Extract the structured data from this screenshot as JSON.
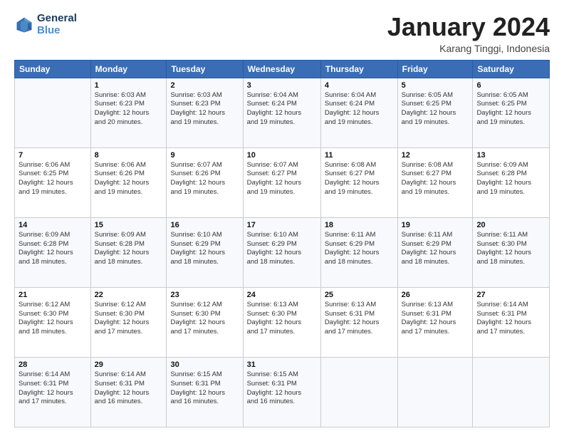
{
  "logo": {
    "line1": "General",
    "line2": "Blue"
  },
  "title": "January 2024",
  "location": "Karang Tinggi, Indonesia",
  "days_of_week": [
    "Sunday",
    "Monday",
    "Tuesday",
    "Wednesday",
    "Thursday",
    "Friday",
    "Saturday"
  ],
  "weeks": [
    [
      {
        "day": "",
        "info": ""
      },
      {
        "day": "1",
        "info": "Sunrise: 6:03 AM\nSunset: 6:23 PM\nDaylight: 12 hours\nand 20 minutes."
      },
      {
        "day": "2",
        "info": "Sunrise: 6:03 AM\nSunset: 6:23 PM\nDaylight: 12 hours\nand 19 minutes."
      },
      {
        "day": "3",
        "info": "Sunrise: 6:04 AM\nSunset: 6:24 PM\nDaylight: 12 hours\nand 19 minutes."
      },
      {
        "day": "4",
        "info": "Sunrise: 6:04 AM\nSunset: 6:24 PM\nDaylight: 12 hours\nand 19 minutes."
      },
      {
        "day": "5",
        "info": "Sunrise: 6:05 AM\nSunset: 6:25 PM\nDaylight: 12 hours\nand 19 minutes."
      },
      {
        "day": "6",
        "info": "Sunrise: 6:05 AM\nSunset: 6:25 PM\nDaylight: 12 hours\nand 19 minutes."
      }
    ],
    [
      {
        "day": "7",
        "info": "Sunrise: 6:06 AM\nSunset: 6:25 PM\nDaylight: 12 hours\nand 19 minutes."
      },
      {
        "day": "8",
        "info": "Sunrise: 6:06 AM\nSunset: 6:26 PM\nDaylight: 12 hours\nand 19 minutes."
      },
      {
        "day": "9",
        "info": "Sunrise: 6:07 AM\nSunset: 6:26 PM\nDaylight: 12 hours\nand 19 minutes."
      },
      {
        "day": "10",
        "info": "Sunrise: 6:07 AM\nSunset: 6:27 PM\nDaylight: 12 hours\nand 19 minutes."
      },
      {
        "day": "11",
        "info": "Sunrise: 6:08 AM\nSunset: 6:27 PM\nDaylight: 12 hours\nand 19 minutes."
      },
      {
        "day": "12",
        "info": "Sunrise: 6:08 AM\nSunset: 6:27 PM\nDaylight: 12 hours\nand 19 minutes."
      },
      {
        "day": "13",
        "info": "Sunrise: 6:09 AM\nSunset: 6:28 PM\nDaylight: 12 hours\nand 19 minutes."
      }
    ],
    [
      {
        "day": "14",
        "info": "Sunrise: 6:09 AM\nSunset: 6:28 PM\nDaylight: 12 hours\nand 18 minutes."
      },
      {
        "day": "15",
        "info": "Sunrise: 6:09 AM\nSunset: 6:28 PM\nDaylight: 12 hours\nand 18 minutes."
      },
      {
        "day": "16",
        "info": "Sunrise: 6:10 AM\nSunset: 6:29 PM\nDaylight: 12 hours\nand 18 minutes."
      },
      {
        "day": "17",
        "info": "Sunrise: 6:10 AM\nSunset: 6:29 PM\nDaylight: 12 hours\nand 18 minutes."
      },
      {
        "day": "18",
        "info": "Sunrise: 6:11 AM\nSunset: 6:29 PM\nDaylight: 12 hours\nand 18 minutes."
      },
      {
        "day": "19",
        "info": "Sunrise: 6:11 AM\nSunset: 6:29 PM\nDaylight: 12 hours\nand 18 minutes."
      },
      {
        "day": "20",
        "info": "Sunrise: 6:11 AM\nSunset: 6:30 PM\nDaylight: 12 hours\nand 18 minutes."
      }
    ],
    [
      {
        "day": "21",
        "info": "Sunrise: 6:12 AM\nSunset: 6:30 PM\nDaylight: 12 hours\nand 18 minutes."
      },
      {
        "day": "22",
        "info": "Sunrise: 6:12 AM\nSunset: 6:30 PM\nDaylight: 12 hours\nand 17 minutes."
      },
      {
        "day": "23",
        "info": "Sunrise: 6:12 AM\nSunset: 6:30 PM\nDaylight: 12 hours\nand 17 minutes."
      },
      {
        "day": "24",
        "info": "Sunrise: 6:13 AM\nSunset: 6:30 PM\nDaylight: 12 hours\nand 17 minutes."
      },
      {
        "day": "25",
        "info": "Sunrise: 6:13 AM\nSunset: 6:31 PM\nDaylight: 12 hours\nand 17 minutes."
      },
      {
        "day": "26",
        "info": "Sunrise: 6:13 AM\nSunset: 6:31 PM\nDaylight: 12 hours\nand 17 minutes."
      },
      {
        "day": "27",
        "info": "Sunrise: 6:14 AM\nSunset: 6:31 PM\nDaylight: 12 hours\nand 17 minutes."
      }
    ],
    [
      {
        "day": "28",
        "info": "Sunrise: 6:14 AM\nSunset: 6:31 PM\nDaylight: 12 hours\nand 17 minutes."
      },
      {
        "day": "29",
        "info": "Sunrise: 6:14 AM\nSunset: 6:31 PM\nDaylight: 12 hours\nand 16 minutes."
      },
      {
        "day": "30",
        "info": "Sunrise: 6:15 AM\nSunset: 6:31 PM\nDaylight: 12 hours\nand 16 minutes."
      },
      {
        "day": "31",
        "info": "Sunrise: 6:15 AM\nSunset: 6:31 PM\nDaylight: 12 hours\nand 16 minutes."
      },
      {
        "day": "",
        "info": ""
      },
      {
        "day": "",
        "info": ""
      },
      {
        "day": "",
        "info": ""
      }
    ]
  ]
}
